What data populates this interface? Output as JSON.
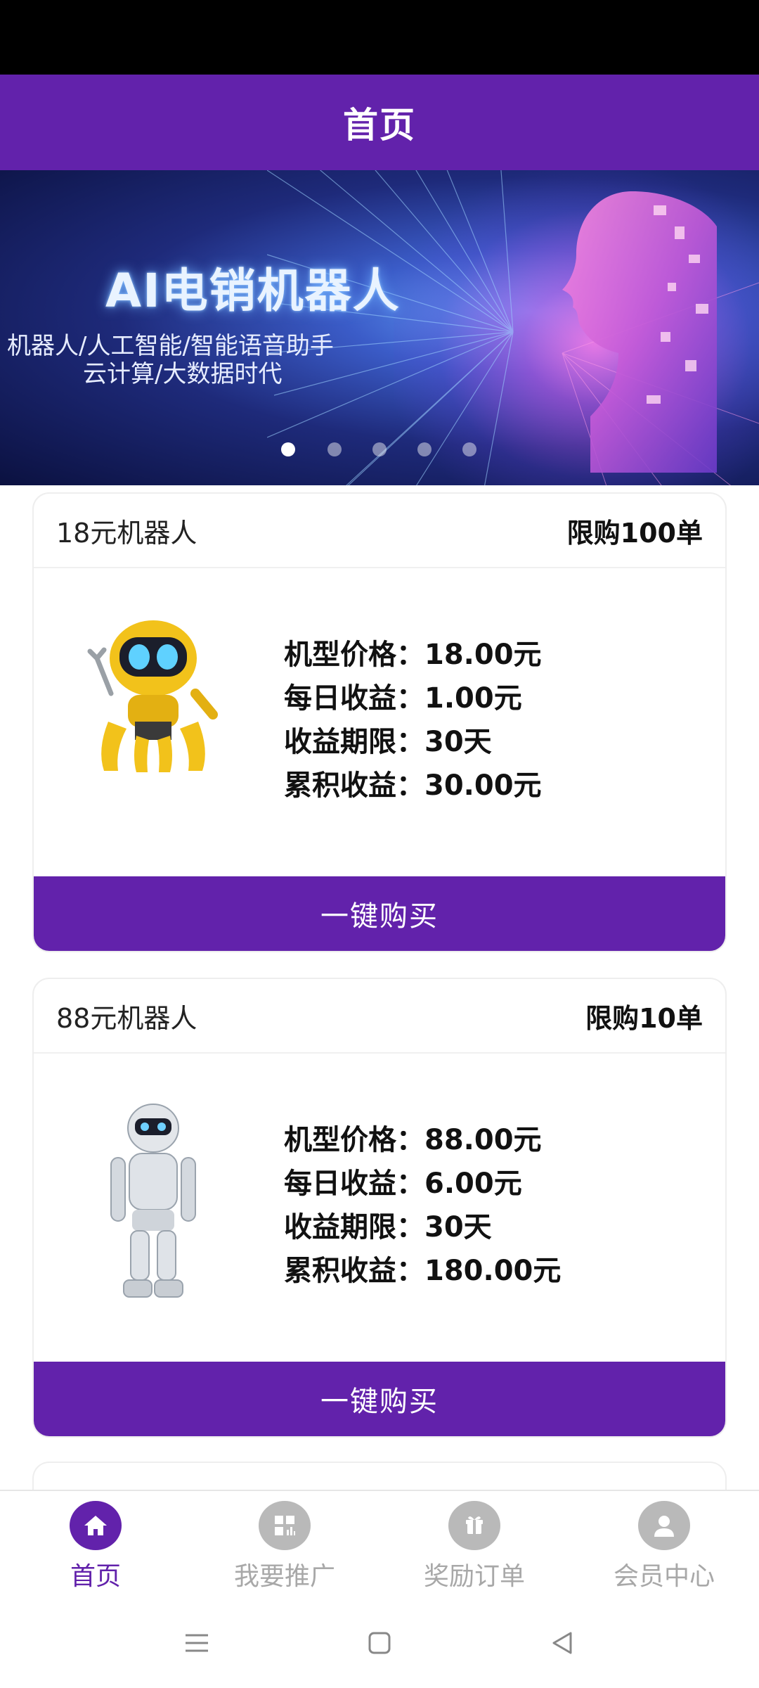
{
  "header": {
    "title": "首页"
  },
  "banner": {
    "headline": "AI电销机器人",
    "subtitle_line1": "机器人/人工智能/智能语音助手",
    "subtitle_line2": "云计算/大数据时代",
    "slide_count": 5,
    "active_slide": 1
  },
  "products": [
    {
      "name": "18元机器人",
      "limit": "限购100单",
      "price_label": "机型价格：",
      "price_value": "18.00元",
      "daily_label": "每日收益：",
      "daily_value": "1.00元",
      "period_label": "收益期限：",
      "period_value": "30天",
      "total_label": "累积收益：",
      "total_value": "30.00元",
      "buy_label": "一键购买",
      "robot_color": "#f2c21b"
    },
    {
      "name": "88元机器人",
      "limit": "限购10单",
      "price_label": "机型价格：",
      "price_value": "88.00元",
      "daily_label": "每日收益：",
      "daily_value": "6.00元",
      "period_label": "收益期限：",
      "period_value": "30天",
      "total_label": "累积收益：",
      "total_value": "180.00元",
      "buy_label": "一键购买",
      "robot_color": "#d9dde2"
    }
  ],
  "tabbar": {
    "items": [
      {
        "label": "首页",
        "icon": "home-icon",
        "active": true
      },
      {
        "label": "我要推广",
        "icon": "promote-icon",
        "active": false
      },
      {
        "label": "奖励订单",
        "icon": "gift-order-icon",
        "active": false
      },
      {
        "label": "会员中心",
        "icon": "user-icon",
        "active": false
      }
    ]
  },
  "colors": {
    "primary": "#6222ab",
    "inactive": "#b9b9b9"
  }
}
